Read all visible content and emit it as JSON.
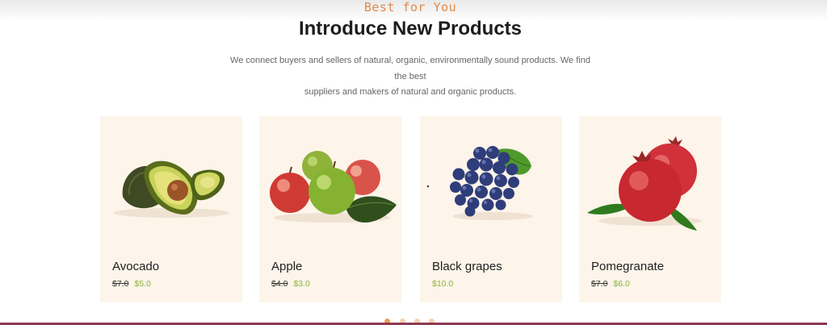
{
  "section": {
    "tagline": "Best for You",
    "title": "Introduce New Products",
    "description_line1": "We connect buyers and sellers of natural, organic, environmentally sound products. We find the best",
    "description_line2": "suppliers and makers of natural and organic products."
  },
  "products": [
    {
      "name": "Avocado",
      "old_price": "$7.0",
      "price": "$5.0",
      "image": "avocado"
    },
    {
      "name": "Apple",
      "old_price": "$4.0",
      "price": "$3.0",
      "image": "apples"
    },
    {
      "name": "Black grapes",
      "old_price": "",
      "price": "$10.0",
      "image": "grapes"
    },
    {
      "name": "Pomegranate",
      "old_price": "$7.0",
      "price": "$6.0",
      "image": "pomegranate"
    }
  ],
  "carousel": {
    "pages": 4,
    "active_index": 0
  },
  "colors": {
    "tagline": "#e08a4a",
    "card_bg": "#fdf4ea",
    "price": "#8cb33a",
    "dot_active": "#f29a52",
    "dot_inactive": "#f2d2b4"
  }
}
